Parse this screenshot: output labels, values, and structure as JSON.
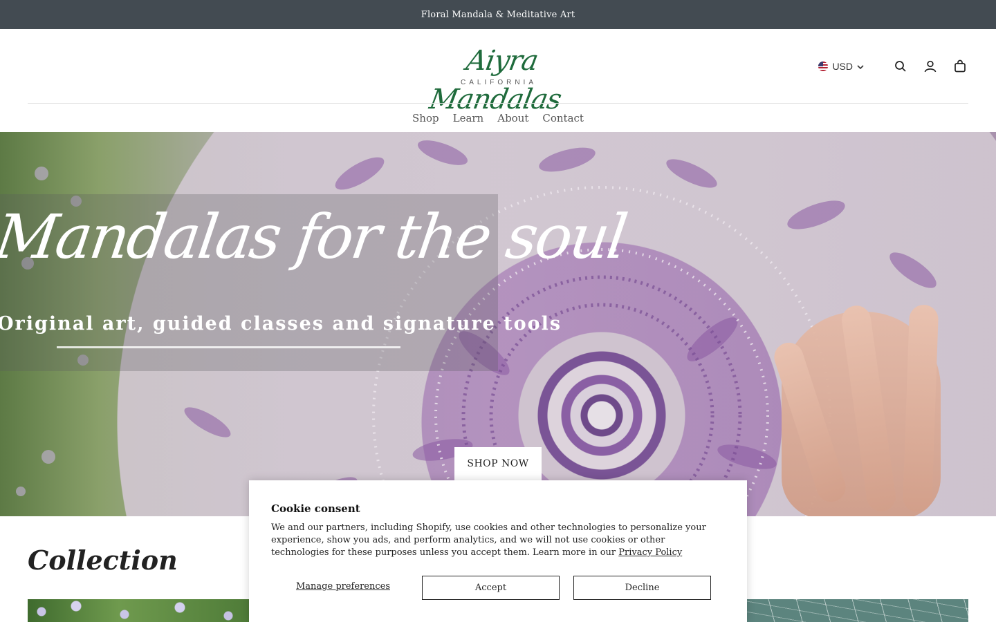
{
  "announcement": "Floral Mandala & Meditative Art",
  "brand": {
    "name": "Aiyra Mandalas",
    "location": "CALIFORNIA",
    "color": "#1f6b3c"
  },
  "header_tools": {
    "currency": "USD",
    "icons": [
      "flag-us-icon",
      "chevron-down-icon",
      "search-icon",
      "account-icon",
      "cart-icon"
    ]
  },
  "nav": {
    "items": [
      {
        "label": "Shop"
      },
      {
        "label": "Learn"
      },
      {
        "label": "About"
      },
      {
        "label": "Contact"
      }
    ]
  },
  "hero": {
    "title": "Mandalas for the soul",
    "subtitle": "Original art, guided classes and signature tools",
    "cta": "SHOP NOW"
  },
  "collection": {
    "title": "Collection"
  },
  "cookie": {
    "title": "Cookie consent",
    "text": "We and our partners, including Shopify, use cookies and other technologies to personalize your experience, show you ads, and perform analytics, and we will not use cookies or other technologies for these purposes unless you accept them. Learn more in our",
    "link": "Privacy Policy",
    "manage": "Manage preferences",
    "accept": "Accept",
    "decline": "Decline"
  },
  "colors": {
    "announcement_bg": "#434b52",
    "text": "#2b2b2b"
  }
}
